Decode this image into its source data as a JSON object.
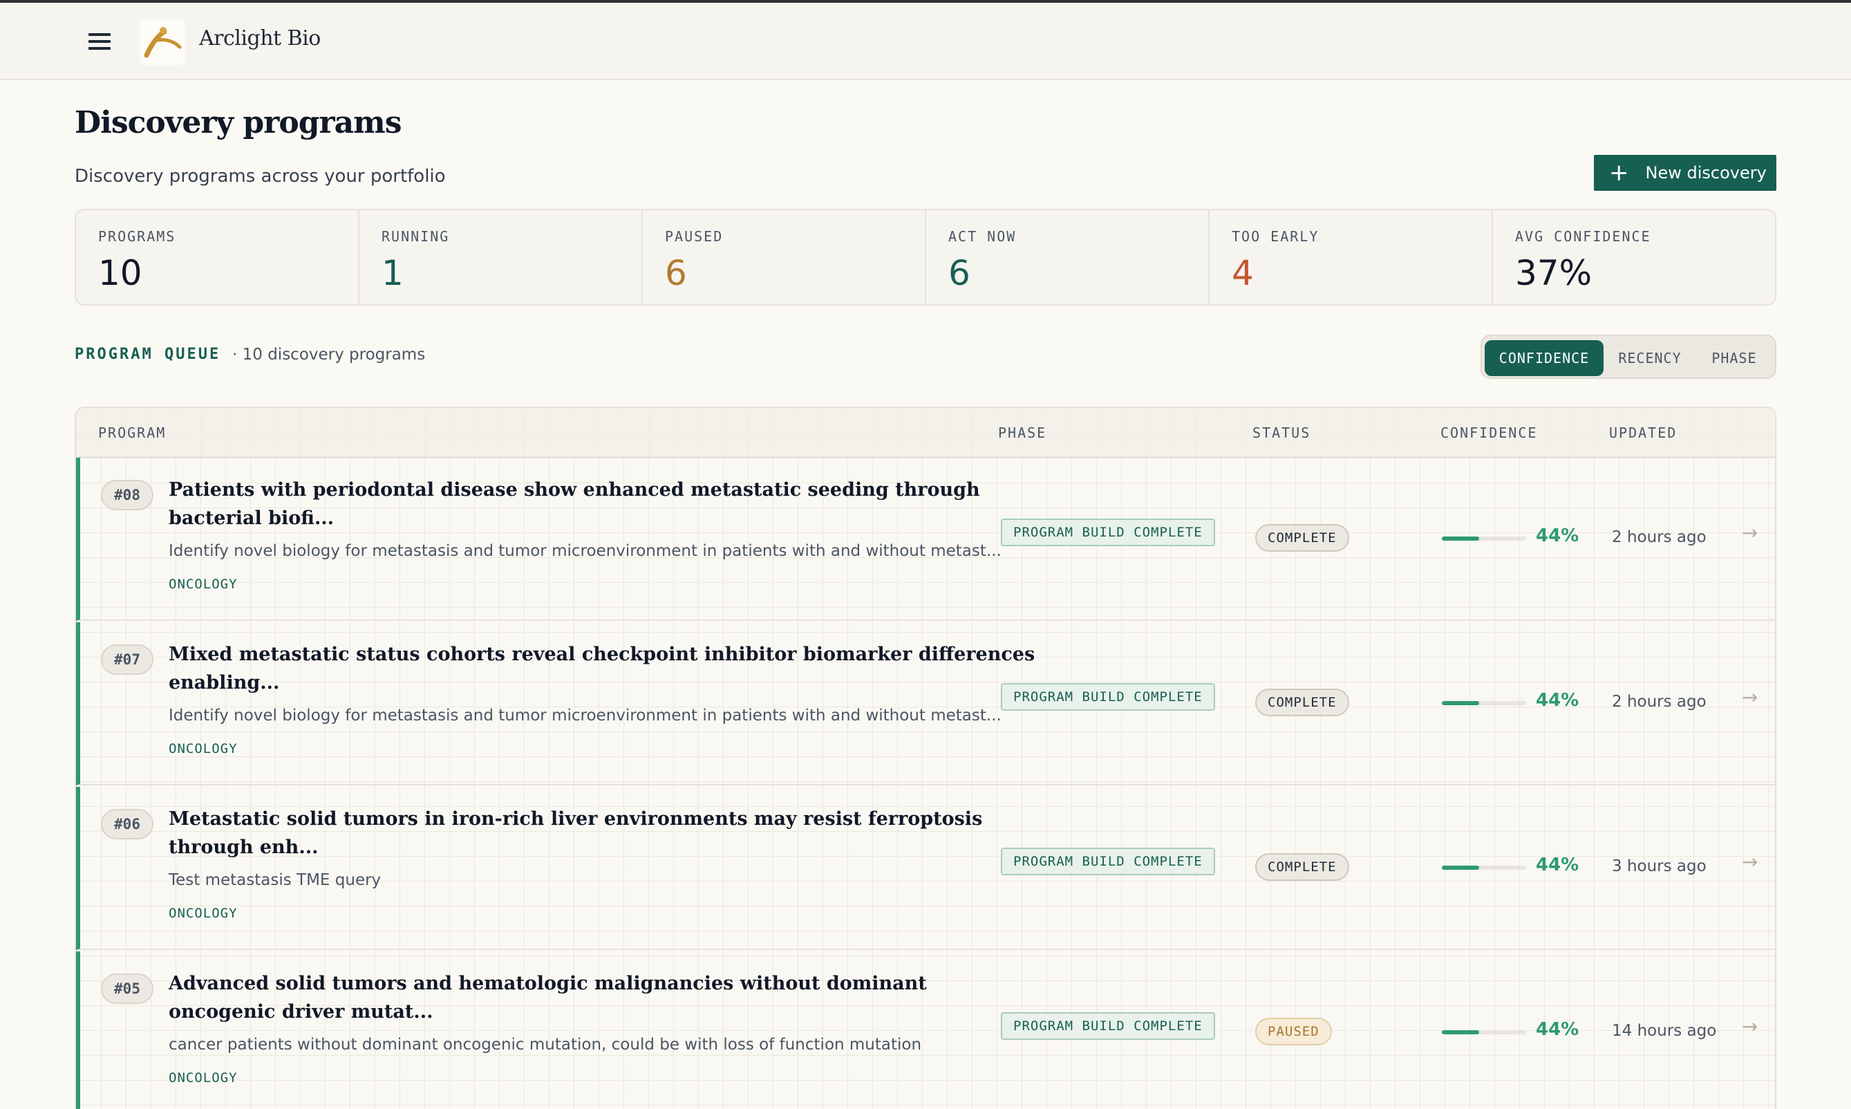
{
  "app": {
    "brand": "Arclight Bio",
    "accent": "#175f52"
  },
  "page": {
    "title": "Discovery programs",
    "subtitle": "Discovery programs across your portfolio",
    "new_button": "New discovery"
  },
  "stats": [
    {
      "label": "PROGRAMS",
      "value": "10",
      "color": "#111827"
    },
    {
      "label": "RUNNING",
      "value": "1",
      "color": "#175f52"
    },
    {
      "label": "PAUSED",
      "value": "6",
      "color": "#b07a2e"
    },
    {
      "label": "ACT NOW",
      "value": "6",
      "color": "#175f52"
    },
    {
      "label": "TOO EARLY",
      "value": "4",
      "color": "#c4552f"
    },
    {
      "label": "AVG CONFIDENCE",
      "value": "37%",
      "color": "#111827"
    }
  ],
  "queue": {
    "label": "PROGRAM QUEUE",
    "count": "· 10 discovery programs",
    "sort_options": [
      "CONFIDENCE",
      "RECENCY",
      "PHASE"
    ],
    "active_sort": "CONFIDENCE"
  },
  "table": {
    "headers": {
      "program": "PROGRAM",
      "phase": "PHASE",
      "status": "STATUS",
      "confidence": "CONFIDENCE",
      "updated": "UPDATED"
    },
    "rows": [
      {
        "num": "#08",
        "title": "Patients with periodontal disease show enhanced metastatic seeding through bacterial biofi...",
        "desc": "Identify novel biology for metastasis and tumor microenvironment in patients with and without metast...",
        "tag": "ONCOLOGY",
        "phase": "PROGRAM BUILD COMPLETE",
        "status": "COMPLETE",
        "confidence": "44%",
        "confidence_fraction": 0.44,
        "updated": "2 hours ago"
      },
      {
        "num": "#07",
        "title": "Mixed metastatic status cohorts reveal checkpoint inhibitor biomarker differences enabling...",
        "desc": "Identify novel biology for metastasis and tumor microenvironment in patients with and without metast...",
        "tag": "ONCOLOGY",
        "phase": "PROGRAM BUILD COMPLETE",
        "status": "COMPLETE",
        "confidence": "44%",
        "confidence_fraction": 0.44,
        "updated": "2 hours ago"
      },
      {
        "num": "#06",
        "title": "Metastatic solid tumors in iron-rich liver environments may resist ferroptosis through enh...",
        "desc": "Test metastasis TME query",
        "tag": "ONCOLOGY",
        "phase": "PROGRAM BUILD COMPLETE",
        "status": "COMPLETE",
        "confidence": "44%",
        "confidence_fraction": 0.44,
        "updated": "3 hours ago"
      },
      {
        "num": "#05",
        "title": "Advanced solid tumors and hematologic malignancies without dominant oncogenic driver mutat...",
        "desc": "cancer patients without dominant oncogenic mutation, could be with loss of function mutation",
        "tag": "ONCOLOGY",
        "phase": "PROGRAM BUILD COMPLETE",
        "status": "PAUSED",
        "confidence": "44%",
        "confidence_fraction": 0.44,
        "updated": "14 hours ago"
      }
    ]
  }
}
